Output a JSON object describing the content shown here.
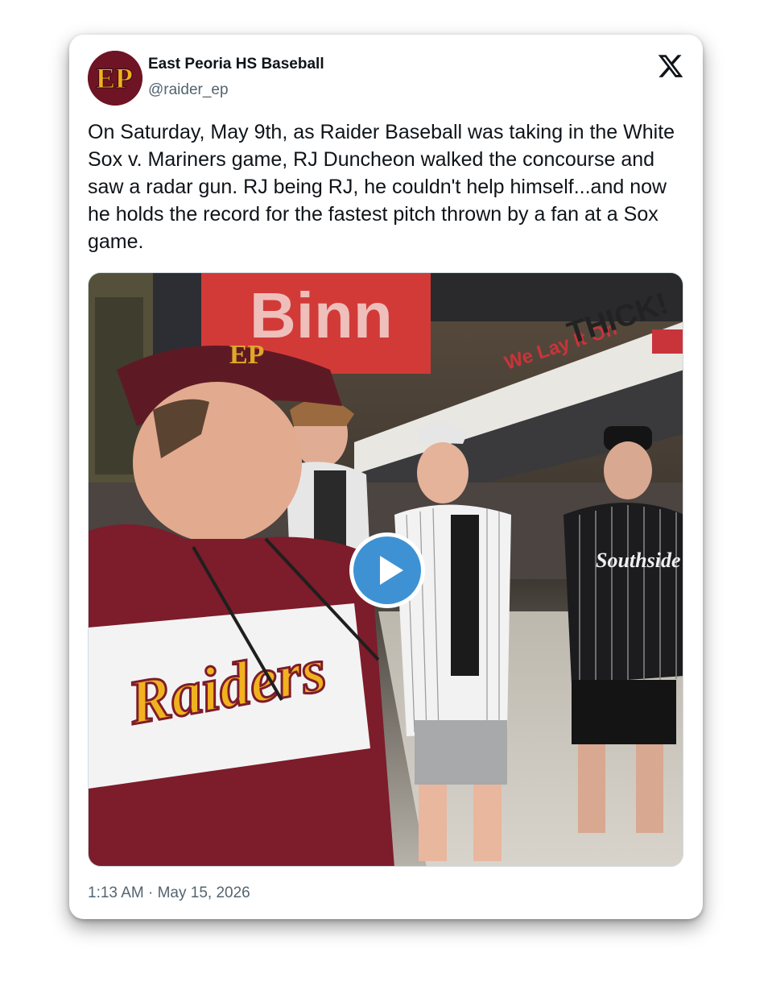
{
  "account": {
    "name": "East Peoria HS Baseball",
    "handle": "@raider_ep",
    "avatar_text": "EP"
  },
  "tweet": {
    "text": "On Saturday, May 9th, as Raider Baseball was taking in the White Sox v. Mariners game, RJ Duncheon walked the concourse and saw a radar gun. RJ being RJ, he couldn't help himself...and now he holds the record for the fastest pitch thrown by a fan at a Sox game.",
    "timestamp": "1:13 AM · May 15, 2026"
  },
  "media": {
    "type": "video",
    "play_icon": "play-icon",
    "signage": [
      "We Lay It On",
      "THICK!",
      "Raiders",
      "Southside"
    ]
  },
  "icons": {
    "brand": "x-logo-icon"
  },
  "colors": {
    "maroon": "#6e1424",
    "gold": "#f0b21e",
    "play_blue": "#3e92d4",
    "text": "#0f1419",
    "secondary_text": "#536471"
  }
}
